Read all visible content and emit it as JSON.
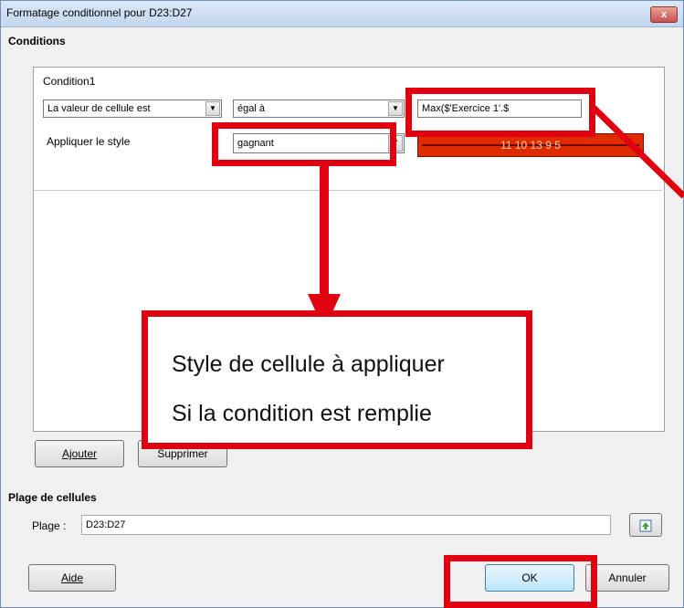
{
  "window": {
    "title": "Formatage conditionnel pour D23:D27",
    "close_glyph": "x"
  },
  "conditions": {
    "heading": "Conditions",
    "condition1": {
      "title": "Condition1",
      "type_value": "La valeur de cellule est",
      "operator_value": "égal à",
      "formula_value": "Max($'Exercice 1'.$",
      "apply_style_label": "Appliquer le style",
      "style_value": "gagnant",
      "preview_text": "11 10 13 9 5"
    },
    "add_label": "Ajouter",
    "remove_label": "Supprimer"
  },
  "range": {
    "heading": "Plage de cellules",
    "label": "Plage :",
    "value": "D23:D27"
  },
  "buttons": {
    "help": "Aide",
    "ok": "OK",
    "cancel": "Annuler"
  },
  "callout": {
    "line1": "Style de cellule à appliquer",
    "line2": "Si la condition est remplie"
  },
  "colors": {
    "annotation": "#e00010",
    "preview_bg": "#e02a00"
  }
}
